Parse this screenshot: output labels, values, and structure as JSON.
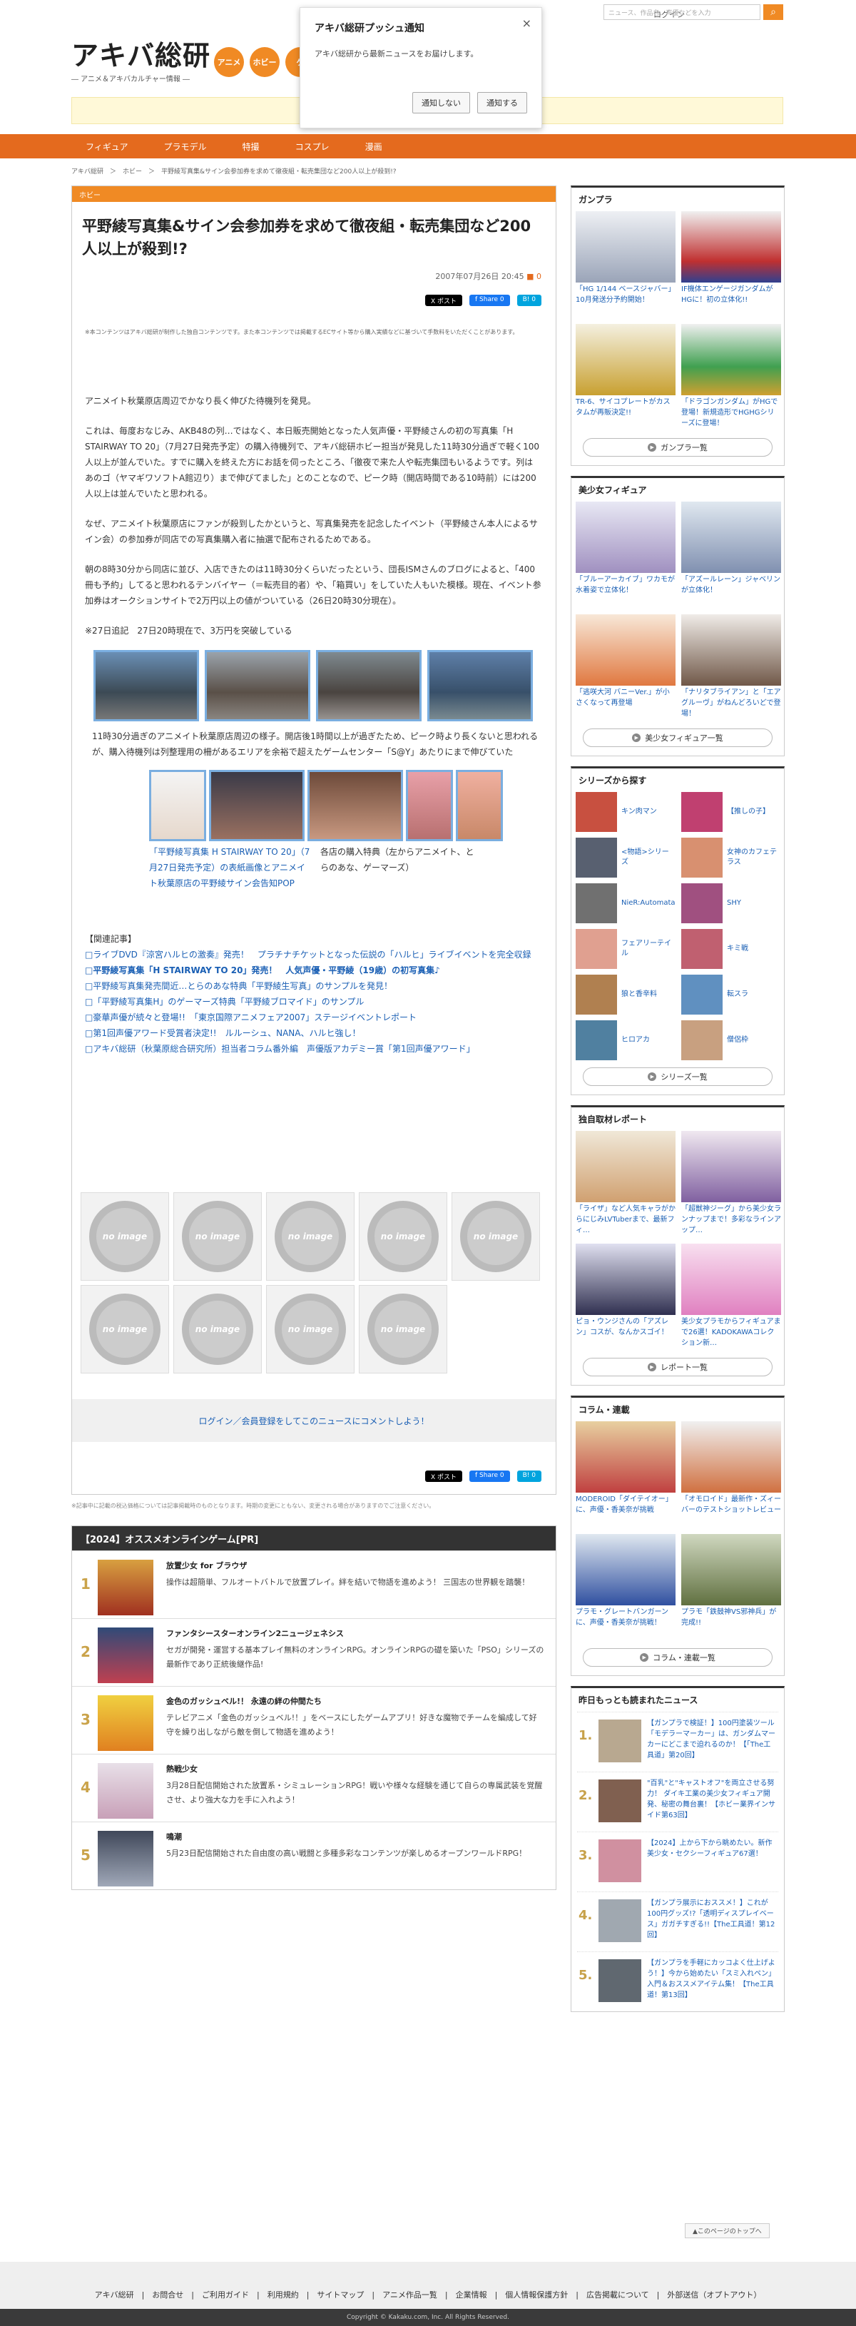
{
  "site": {
    "logo": "アキバ総研",
    "logo_sub": "― アニメ＆アキバカルチャー情報 ―",
    "categories": [
      "アニメ",
      "ホビー",
      "ゲ"
    ],
    "login": "ログイン",
    "search_placeholder": "ニュース、作品名、声優などを入力",
    "search_icon": "search-icon"
  },
  "push": {
    "title": "アキバ総研プッシュ通知",
    "body": "アキバ総研から最新ニュースをお届けします。",
    "deny": "通知しない",
    "allow": "通知する",
    "close": "×"
  },
  "nav": [
    "フィギュア",
    "プラモデル",
    "特撮",
    "コスプレ",
    "漫画"
  ],
  "breadcrumb": "アキバ総研　＞　ホビー　＞　平野綾写真集&サイン会参加券を求めて徹夜組・転売集団など200人以上が殺到!?",
  "article": {
    "category": "ホビー",
    "title": "平野綾写真集&サイン会参加券を求めて徹夜組・転売集団など200人以上が殺到!?",
    "date": "2007年07月26日 20:45",
    "comments": "0",
    "share_x": "X ポスト",
    "share_fb": "f Share 0",
    "share_hb": "B! 0",
    "note": "※本コンテンツはアキバ総研が制作した独自コンテンツです。また本コンテンツでは掲載するECサイト等から購入実績などに基づいて手数料をいただくことがあります。",
    "p1": "アニメイト秋葉原店周辺でかなり長く伸びた待機列を発見。",
    "p2": "これは、毎度おなじみ、AKB48の列…ではなく、本日販売開始となった人気声優・平野綾さんの初の写真集「H STAIRWAY TO 20」（7月27日発売予定）の購入待機列で、アキバ総研ホビー担当が発見した11時30分過ぎで軽く100人以上が並んでいた。すでに購入を終えた方にお話を伺ったところ、「徹夜で来た人や転売集団もいるようです。列はあのゴ（ヤマギワソフトA館辺り）まで伸びてました」とのことなので、ピーク時（開店時間である10時前）には200人以上は並んでいたと思われる。",
    "p3": "なぜ、アニメイト秋葉原店にファンが殺到したかというと、写真集発売を記念したイベント（平野綾さん本人によるサイン会）の参加券が同店での写真集購入者に抽選で配布されるためである。",
    "p4": "朝の8時30分から同店に並び、入店できたのは11時30分くらいだったという、団長ISMさんのブログによると、「400冊も予約」してると思われるテンバイヤー（＝転売目的者）や、「箱買い」をしていた人もいた模様。現在、イベント参加券はオークションサイトで2万円以上の値がついている（26日20時30分現在）。",
    "p5": "※27日追記　27日20時現在で、3万円を突破している",
    "cap1": "11時30分過ぎのアニメイト秋葉原店周辺の様子。開店後1時間以上が過ぎたため、ピーク時より長くないと思われるが、購入待機列は列整理用の柵があるエリアを余裕で超えたゲームセンター「S@Y」あたりにまで伸びていた",
    "cap2a": "「平野綾写真集 H STAIRWAY TO 20」（7月27日発売予定）の表紙画像とアニメイト秋葉原店の平野綾サイン会告知POP",
    "cap2b": "各店の購入特典（左からアニメイト、とらのあな、ゲーマーズ）",
    "related_h": "【関連記事】",
    "related": [
      "□ライブDVD『涼宮ハルヒの激奏』発売！　プラチナチケットとなった伝説の「ハルヒ」ライブイベントを完全収録",
      "□平野綾写真集「H STAIRWAY TO 20」発売！　人気声優・平野綾（19歳）の初写真集♪",
      "□平野綾写真集発売間近…とらのあな特典「平野綾生写真」のサンプルを発見！",
      "□「平野綾写真集H」のゲーマーズ特典「平野綾ブロマイド」のサンプル",
      "□豪華声優が続々と登場!!　「東京国際アニメフェア2007」ステージイベントレポート",
      "□第1回声優アワード受賞者決定!!　ルルーシュ、NANA、ハルヒ強し！",
      "□アキバ総研（秋葉原総合研究所）担当者コラム番外編　声優版アカデミー賞「第1回声優アワード」"
    ],
    "noimage": "no image",
    "comment_prompt": "ログイン／会員登録をしてこのニュースにコメントしよう！"
  },
  "disclaimer": "※記事中に記載の税込価格については記事掲載時のものとなります。時期の変更にともない、変更される場合がありますのでご注意ください。",
  "pr": {
    "header": "【2024】オススメオンラインゲーム[PR]",
    "items": [
      {
        "rank": "1",
        "name": "放置少女 for ブラウザ",
        "desc": "操作は超簡単、フルオートバトルで放置プレイ。絆を結いで物語を進めよう！ 三国志の世界観を踏襲！"
      },
      {
        "rank": "2",
        "name": "ファンタシースターオンライン2ニュージェネシス",
        "desc": "セガが開発・運営する基本プレイ無料のオンラインRPG。オンラインRPGの礎を築いた「PSO」シリーズの最新作であり正統後継作品!"
      },
      {
        "rank": "3",
        "name": "金色のガッシュベル!！ 永遠の絆の仲間たち",
        "desc": "テレビアニメ「金色のガッシュベル!！」をベースにしたゲームアプリ！好きな魔物でチームを編成して好守を繰り出しながら敵を倒して物語を進めよう！"
      },
      {
        "rank": "4",
        "name": "熱戦少女",
        "desc": "3月28日配信開始された放置系・シミュレーションRPG！戦いや様々な経験を通じて自らの専属武装を覚醒させ、より強大な力を手に入れよう！"
      },
      {
        "rank": "5",
        "name": "鳴潮",
        "desc": "5月23日配信開始された自由度の高い戦闘と多種多彩なコンテンツが楽しめるオープンワールドRPG！"
      }
    ]
  },
  "sidebar": {
    "gunpla": {
      "title": "ガンプラ",
      "items": [
        "「HG 1/144 ベースジャバー」10月発送分予約開始！",
        "IF機体エンゲージガンダムがHGに！初の立体化!!",
        "TR-6、サイコプレートがカスタムが再販決定!!",
        "「ドラゴンガンダム」がHGで登場！新規造形でHGHGシリーズに登場！"
      ],
      "more": "ガンプラ一覧"
    },
    "figure": {
      "title": "美少女フィギュア",
      "items": [
        "「ブルーアーカイブ」ワカモが水着姿で立体化！",
        "「アズールレーン」ジャベリンが立体化！",
        "「逃咲大河 バニーVer.」が小さくなって再登場",
        "「ナリタブライアン」と「エアグルーヴ」がねんどろいどで登場！"
      ],
      "more": "美少女フィギュア一覧"
    },
    "series": {
      "title": "シリーズから探す",
      "items": [
        "キン肉マン",
        "【推しの子】",
        "<物語>シリーズ",
        "女神のカフェテラス",
        "NieR:Automata",
        "SHY",
        "フェアリーテイル",
        "キミ戦",
        "狼と香辛料",
        "転スラ",
        "ヒロアカ",
        "僧侶枠"
      ],
      "more": "シリーズ一覧"
    },
    "report": {
      "title": "独自取材レポート",
      "items": [
        "「ライザ」など人気キャラがからにじみLVTuberまで、最新フィ…",
        "「超獣神ジーグ」から美少女ランナップまで！多彩なラインアップ…",
        "ピョ・ウンジさんの「アズレン」コスが、なんかスゴイ！",
        "美少女プラモからフィギュアまで26選！KADOKAWAコレクション新…"
      ],
      "more": "レポート一覧"
    },
    "column": {
      "title": "コラム・連載",
      "items": [
        "MODEROID「ダイテイオー」に、声優・香美奈が挑戦",
        "「オモロイド」最新作・ズィーバーのテストショットレビュー",
        "プラモ・グレートバンガーンに、声優・香美奈が挑戦！",
        "プラモ「鉄鼓神VS邪神兵」が完成!!"
      ],
      "more": "コラム・連載一覧"
    },
    "yesterday": {
      "title": "昨日もっとも読まれたニュース",
      "items": [
        {
          "rank": "1.",
          "text": "【ガンプラで検証！】100円塗装ツール「モデラーマーカー」は、ガンダムマーカーにどこまで迫れるのか！【「The工具道」第20回】"
        },
        {
          "rank": "2.",
          "text": "\"百乳\"と\"キャストオフ\"を両立させる努力！ ダイキ工業の美少女フィギュア開発、秘密の舞台裏！【ホビー業界インサイド第63回】"
        },
        {
          "rank": "3.",
          "text": "【2024】上から下から眺めたい。新作美少女・セクシーフィギュア67選！"
        },
        {
          "rank": "4.",
          "text": "【ガンプラ展示におススメ！】これが100円グッズ!?「透明ディスプレイベース」ガガチすぎる!!【The工具道！第12回】"
        },
        {
          "rank": "5.",
          "text": "【ガンプラを手軽にカッコよく仕上げよう！】今から始めたい「スミ入れペン」入門＆おススメアイテム集！【The工具道！第13回】"
        }
      ]
    }
  },
  "pagetop": "▲このページのトップへ",
  "footer": {
    "links": "アキバ総研　|　お問合せ　|　ご利用ガイド　|　利用規約　|　サイトマップ　|　アニメ作品一覧　|　企業情報　|　個人情報保護方針　|　広告掲載について　|　外部送信（オプトアウト）",
    "copyright": "Copyright © Kakaku.com, Inc. All Rights Reserved."
  },
  "colors": {
    "accent": "#f08a24",
    "nav": "#e46a1e",
    "link": "#1a5fb4",
    "header_dark": "#333333"
  }
}
